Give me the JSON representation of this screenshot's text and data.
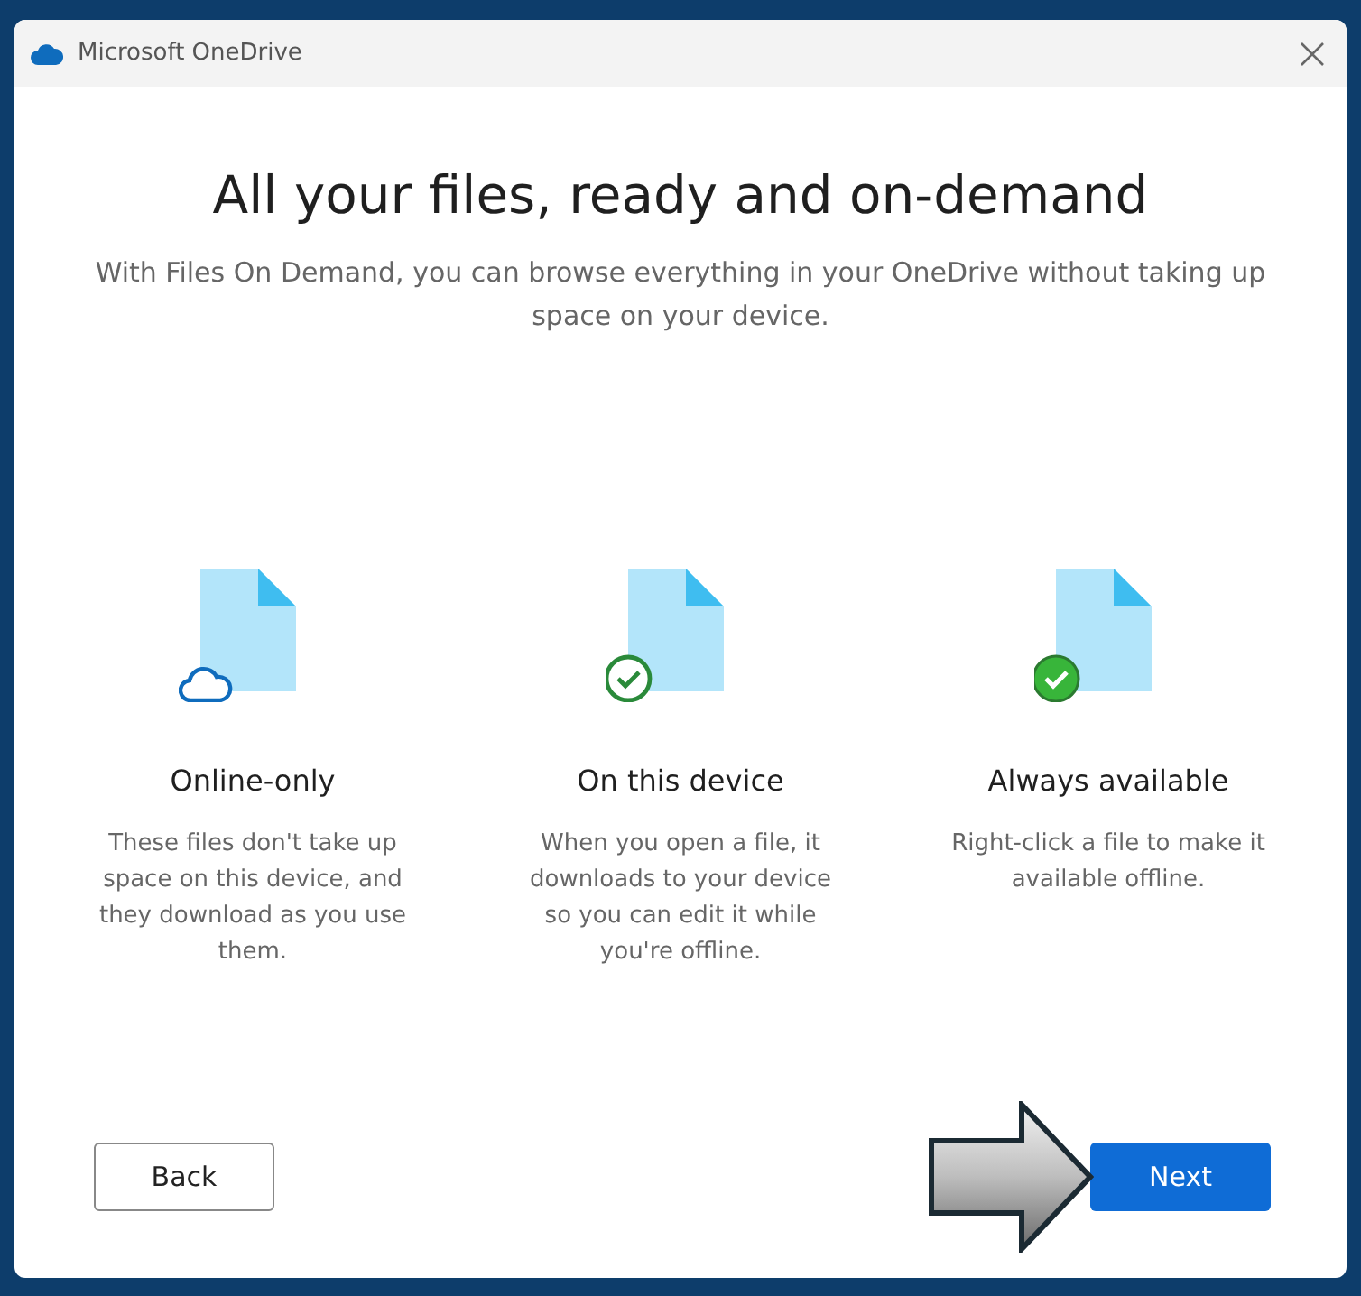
{
  "window": {
    "title": "Microsoft OneDrive"
  },
  "heading": "All your files, ready and on-demand",
  "subtitle": "With Files On Demand, you can browse everything in your OneDrive without taking up space on your device.",
  "options": [
    {
      "kind": "cloud",
      "title": "Online-only",
      "description": "These files don't take up space on this device, and they download as you use them."
    },
    {
      "kind": "check-outline",
      "title": "On this device",
      "description": "When you open a file, it downloads to your device so you can edit it while you're offline."
    },
    {
      "kind": "check-filled",
      "title": "Always available",
      "description": "Right-click a file to make it available offline."
    }
  ],
  "buttons": {
    "back": "Back",
    "next": "Next"
  }
}
